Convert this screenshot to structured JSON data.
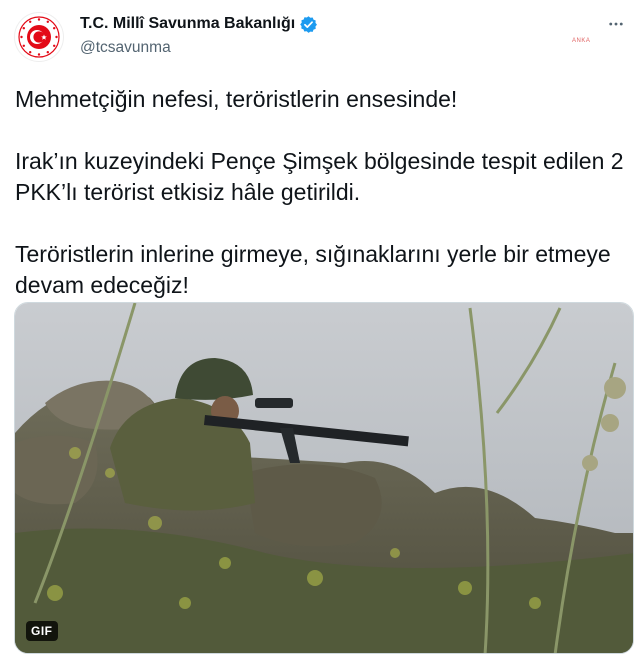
{
  "account": {
    "display_name": "T.C. Millî Savunma Bakanlığı",
    "handle": "@tcsavunma",
    "verified": true,
    "avatar_icon": "ministry-emblem-icon"
  },
  "tweet": {
    "paragraphs": [
      "Mehmetçiğin nefesi, teröristlerin ensesinde!",
      "Irak’ın kuzeyindeki Pençe Şimşek bölgesinde tespit edilen 2 PKK’lı terörist etkisiz hâle getirildi.",
      "Teröristlerin inlerine girmeye, sığınaklarını yerle bir etmeye devam edeceğiz!"
    ]
  },
  "media": {
    "type": "gif",
    "badge": "GIF"
  },
  "menu": {
    "icon": "more-horizontal-icon"
  },
  "watermark": "ANKA",
  "colors": {
    "verified": "#1d9bf0",
    "emblem_red": "#e30a17",
    "handle_gray": "#536471"
  }
}
